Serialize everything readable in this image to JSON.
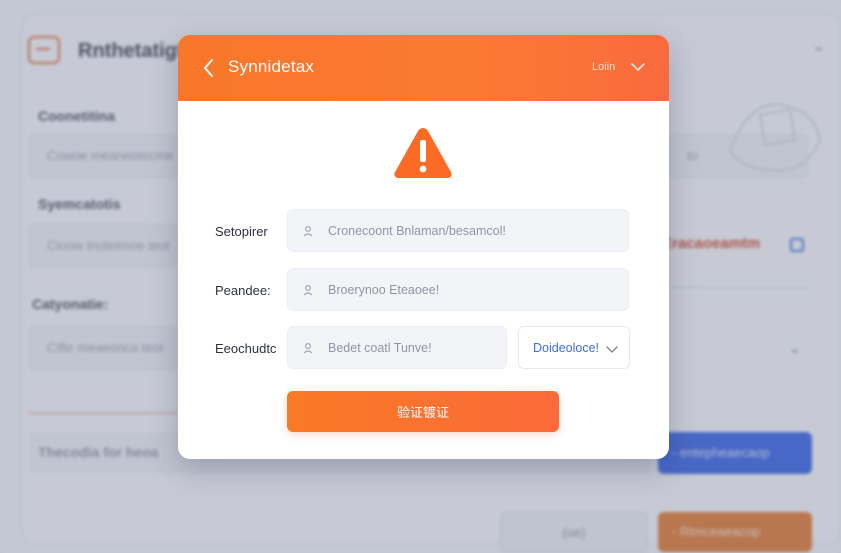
{
  "background": {
    "app_title": "Rnthetatigt",
    "section_labels": [
      "Coonetitina",
      "Syemcatotis",
      "Catyonatie:"
    ],
    "field_texts": [
      "Cowoe meaneotecme ot",
      "Cioow tnotetmoe teot",
      "Cifte meaeonca teot"
    ],
    "right_field_text": "to",
    "alert_text": "Eracaoeamtm",
    "row_text": "Thecodia for heoa",
    "blue_button_label": "- entepheaecaop",
    "gray_button_label": "(oe)",
    "orange_button_label": "- Rtmceaeacop"
  },
  "modal": {
    "title": "Synnidetax",
    "header_action": "Loiin",
    "icons": {
      "back": "chevron-left-icon",
      "menu": "chevron-down-icon",
      "warning": "warning-triangle-icon",
      "field": "input-dot-icon"
    },
    "fields": [
      {
        "label": "Setopirer",
        "placeholder": "Cronecoont Bnlaman/besamcol!"
      },
      {
        "label": "Peandee:",
        "placeholder": "Broerynoo Eteaoee!"
      },
      {
        "label": "Eeochudtc",
        "placeholder": "Bedet coatl Tunve!"
      }
    ],
    "select": {
      "value": "Doideoloce!"
    },
    "submit_label": "验证镀证"
  },
  "colors": {
    "accent": "#f8772a",
    "warning": "#fb6b25",
    "link_blue": "#3f6fd8",
    "background": "#eef1f7"
  }
}
